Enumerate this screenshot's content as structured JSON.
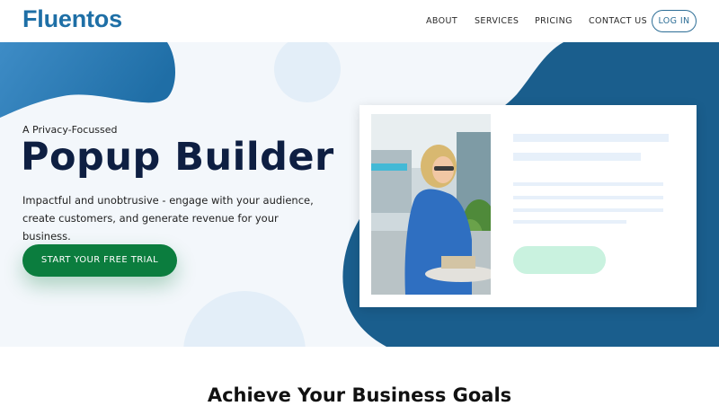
{
  "brand": {
    "logo": "Fluentos"
  },
  "nav": {
    "about": "ABOUT",
    "services": "SERVICES",
    "pricing": "PRICING",
    "contact": "CONTACT US",
    "login": "LOG IN"
  },
  "hero": {
    "tagline": "A Privacy-Focussed",
    "title": "Popup Builder",
    "description": "Impactful and unobtrusive - engage with your audience, create customers, and generate revenue for your business.",
    "cta": "START YOUR FREE TRIAL"
  },
  "section": {
    "title": "Achieve Your Business Goals"
  },
  "colors": {
    "brand_blue": "#1e6fa6",
    "dark_blue": "#1a5e8d",
    "cta_green": "#0b7d3e",
    "mint": "#c9f2df"
  }
}
